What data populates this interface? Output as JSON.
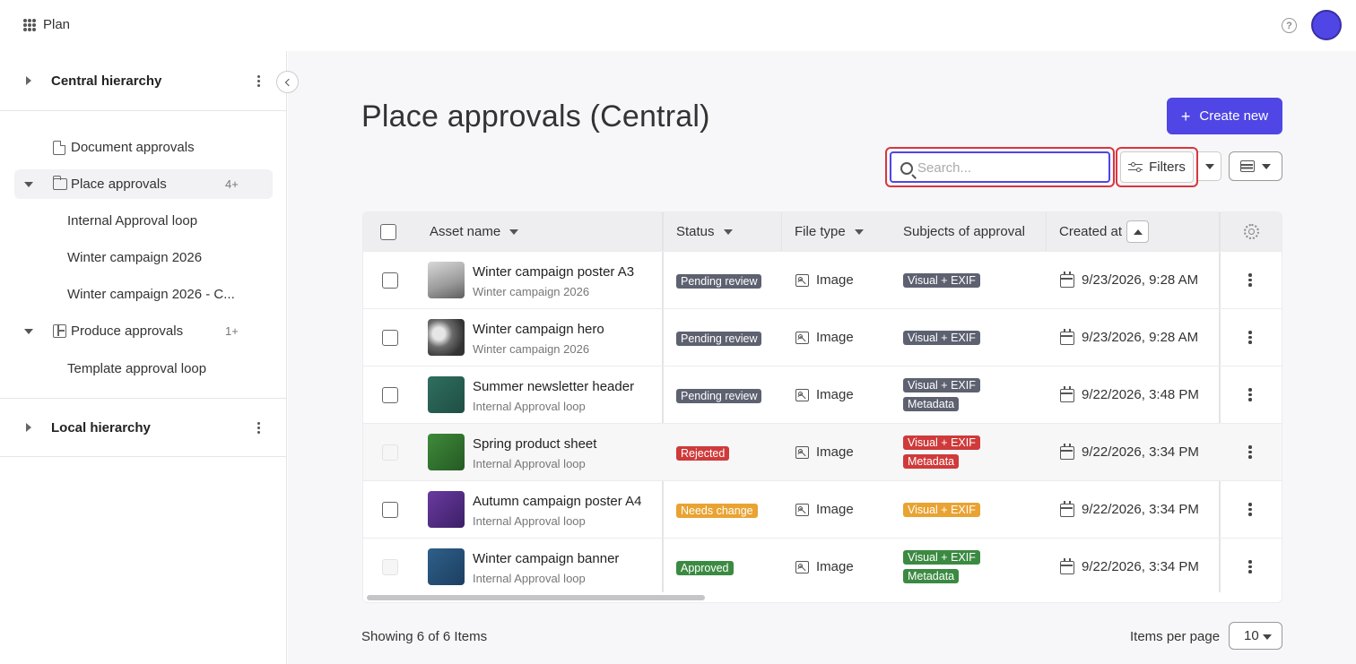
{
  "app": {
    "name": "Plan"
  },
  "sidebar": {
    "central": {
      "title": "Central hierarchy"
    },
    "local": {
      "title": "Local hierarchy"
    },
    "items": [
      {
        "label": "Document approvals"
      },
      {
        "label": "Place approvals",
        "count": "4+"
      },
      {
        "label": "Internal Approval loop"
      },
      {
        "label": "Winter campaign 2026"
      },
      {
        "label": "Winter campaign 2026 - C..."
      },
      {
        "label": "Produce approvals",
        "count": "1+"
      },
      {
        "label": "Template approval loop"
      }
    ]
  },
  "page": {
    "title": "Place approvals (Central)",
    "create_label": "Create new",
    "search_placeholder": "Search...",
    "filters_label": "Filters"
  },
  "table": {
    "columns": {
      "asset": "Asset name",
      "status": "Status",
      "file_type": "File type",
      "subjects": "Subjects of approval",
      "created": "Created at"
    },
    "rows": [
      {
        "name": "Winter campaign poster A3",
        "loop": "Winter campaign 2026",
        "status": "Pending review",
        "file_type": "Image",
        "subjects": [
          "Visual + EXIF"
        ],
        "created": "9/23/2026, 9:28 AM"
      },
      {
        "name": "Winter campaign hero",
        "loop": "Winter campaign 2026",
        "status": "Pending review",
        "file_type": "Image",
        "subjects": [
          "Visual + EXIF"
        ],
        "created": "9/23/2026, 9:28 AM"
      },
      {
        "name": "Summer newsletter header",
        "loop": "Internal Approval loop",
        "status": "Pending review",
        "file_type": "Image",
        "subjects": [
          "Visual + EXIF",
          "Metadata"
        ],
        "created": "9/22/2026, 3:48 PM"
      },
      {
        "name": "Spring product sheet",
        "loop": "Internal Approval loop",
        "status": "Rejected",
        "file_type": "Image",
        "subjects": [
          "Visual + EXIF",
          "Metadata"
        ],
        "created": "9/22/2026, 3:34 PM"
      },
      {
        "name": "Autumn campaign poster A4",
        "loop": "Internal Approval loop",
        "status": "Needs change",
        "file_type": "Image",
        "subjects": [
          "Visual + EXIF"
        ],
        "created": "9/22/2026, 3:34 PM"
      },
      {
        "name": "Winter campaign banner",
        "loop": "Internal Approval loop",
        "status": "Approved",
        "file_type": "Image",
        "subjects": [
          "Visual + EXIF",
          "Metadata"
        ],
        "created": "9/22/2026, 3:34 PM"
      }
    ]
  },
  "footer": {
    "showing": "Showing 6 of 6 Items",
    "items_per_page_label": "Items per page",
    "items_per_page_value": "10"
  },
  "colors": {
    "accent": "#4f46e5",
    "pending": "#5d6170",
    "rejected": "#cf3a3a",
    "needs_change": "#e9a332",
    "approved": "#3b8a42",
    "highlight_border": "#d9363e"
  }
}
